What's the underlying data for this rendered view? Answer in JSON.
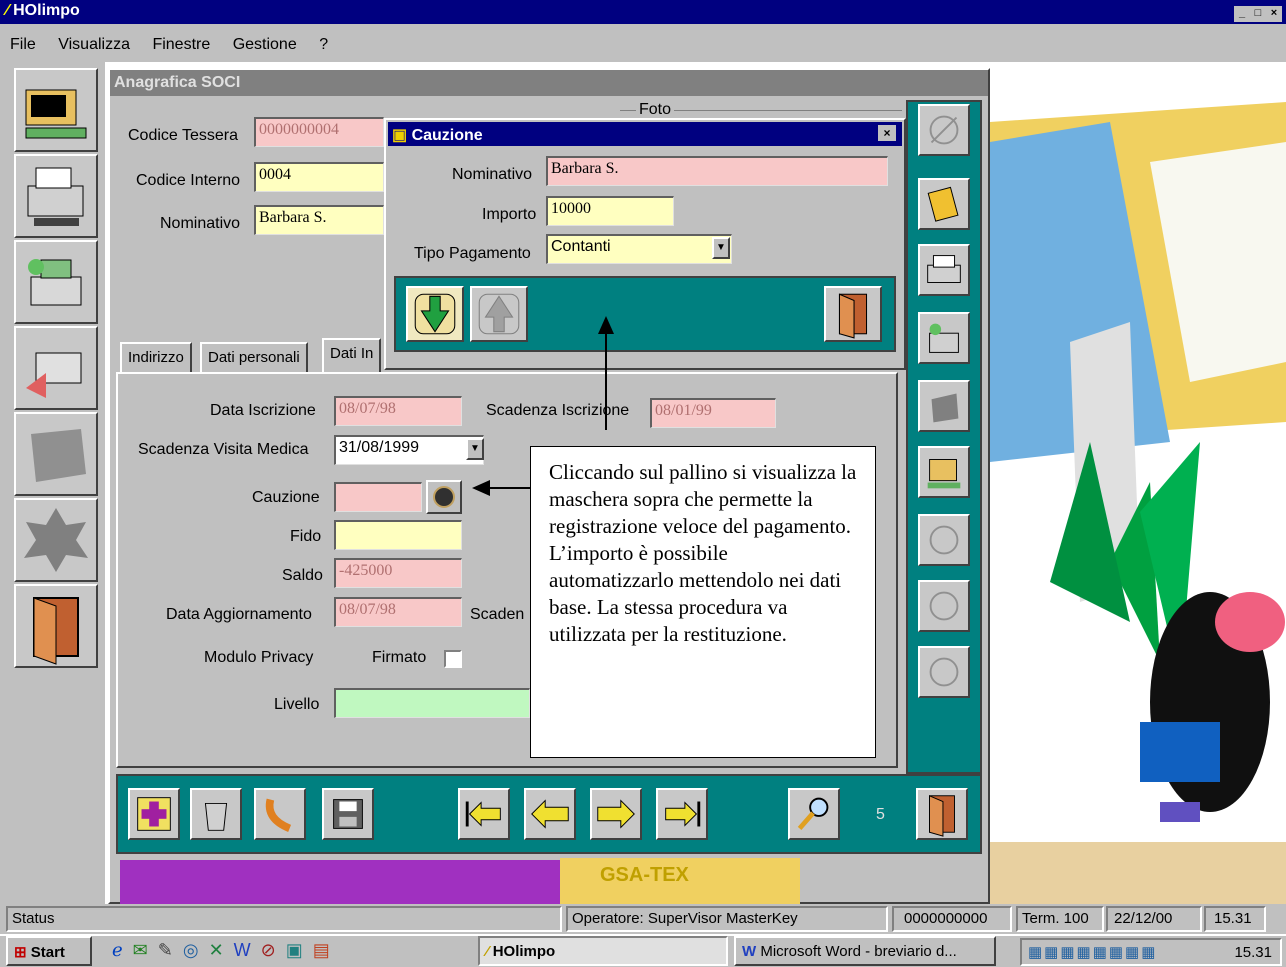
{
  "app": {
    "title": "HOlimpo",
    "menu": [
      "File",
      "Visualizza",
      "Finestre",
      "Gestione",
      "?"
    ]
  },
  "window": {
    "title": "Anagrafica SOCI",
    "foto_label": "Foto",
    "codice_tessera_label": "Codice Tessera",
    "codice_tessera": "0000000004",
    "codice_interno_label": "Codice Interno",
    "codice_interno": "0004",
    "nominativo_label": "Nominativo",
    "nominativo": "Barbara S.",
    "tabs": [
      "Indirizzo",
      "Dati personali",
      "Dati In"
    ],
    "data_iscrizione_label": "Data Iscrizione",
    "data_iscrizione": "08/07/98",
    "scadenza_iscrizione_label": "Scadenza Iscrizione",
    "scadenza_iscrizione": "08/01/99",
    "scadenza_visita_label": "Scadenza Visita Medica",
    "scadenza_visita": "31/08/1999",
    "cauzione_label": "Cauzione",
    "cauzione": "",
    "fido_label": "Fido",
    "fido": "",
    "saldo_label": "Saldo",
    "saldo": "-425000",
    "data_aggiornamento_label": "Data Aggiornamento",
    "data_aggiornamento": "08/07/98",
    "scaden_label": "Scaden",
    "modulo_privacy_label": "Modulo Privacy",
    "firmato_label": "Firmato",
    "livello_label": "Livello",
    "record_count": "5"
  },
  "dialog": {
    "title": "Cauzione",
    "nominativo_label": "Nominativo",
    "nominativo": "Barbara S.",
    "importo_label": "Importo",
    "importo": "10000",
    "tipo_pagamento_label": "Tipo Pagamento",
    "tipo_pagamento": "Contanti"
  },
  "callout": {
    "text": "Cliccando sul pallino si visualizza la maschera sopra che permette la registrazione veloce del pagamento. L’importo è possibile automatizzarlo mettendolo nei dati base. La stessa procedura va utilizzata per la restituzione."
  },
  "statusbar": {
    "status": "Status",
    "operatore": "Operatore: SuperVisor MasterKey",
    "codice": "0000000000",
    "term": "Term. 100",
    "date": "22/12/00",
    "time": "15.31"
  },
  "taskbar": {
    "start": "Start",
    "task1": "HOlimpo",
    "task2": "Microsoft Word - breviario d...",
    "clock": "15.31"
  },
  "colors": {
    "titlebar": "#000080",
    "teal": "#008080",
    "pink_field": "#f8c8c8",
    "yellow_field": "#ffffc0",
    "green_field": "#c0f8c0"
  }
}
